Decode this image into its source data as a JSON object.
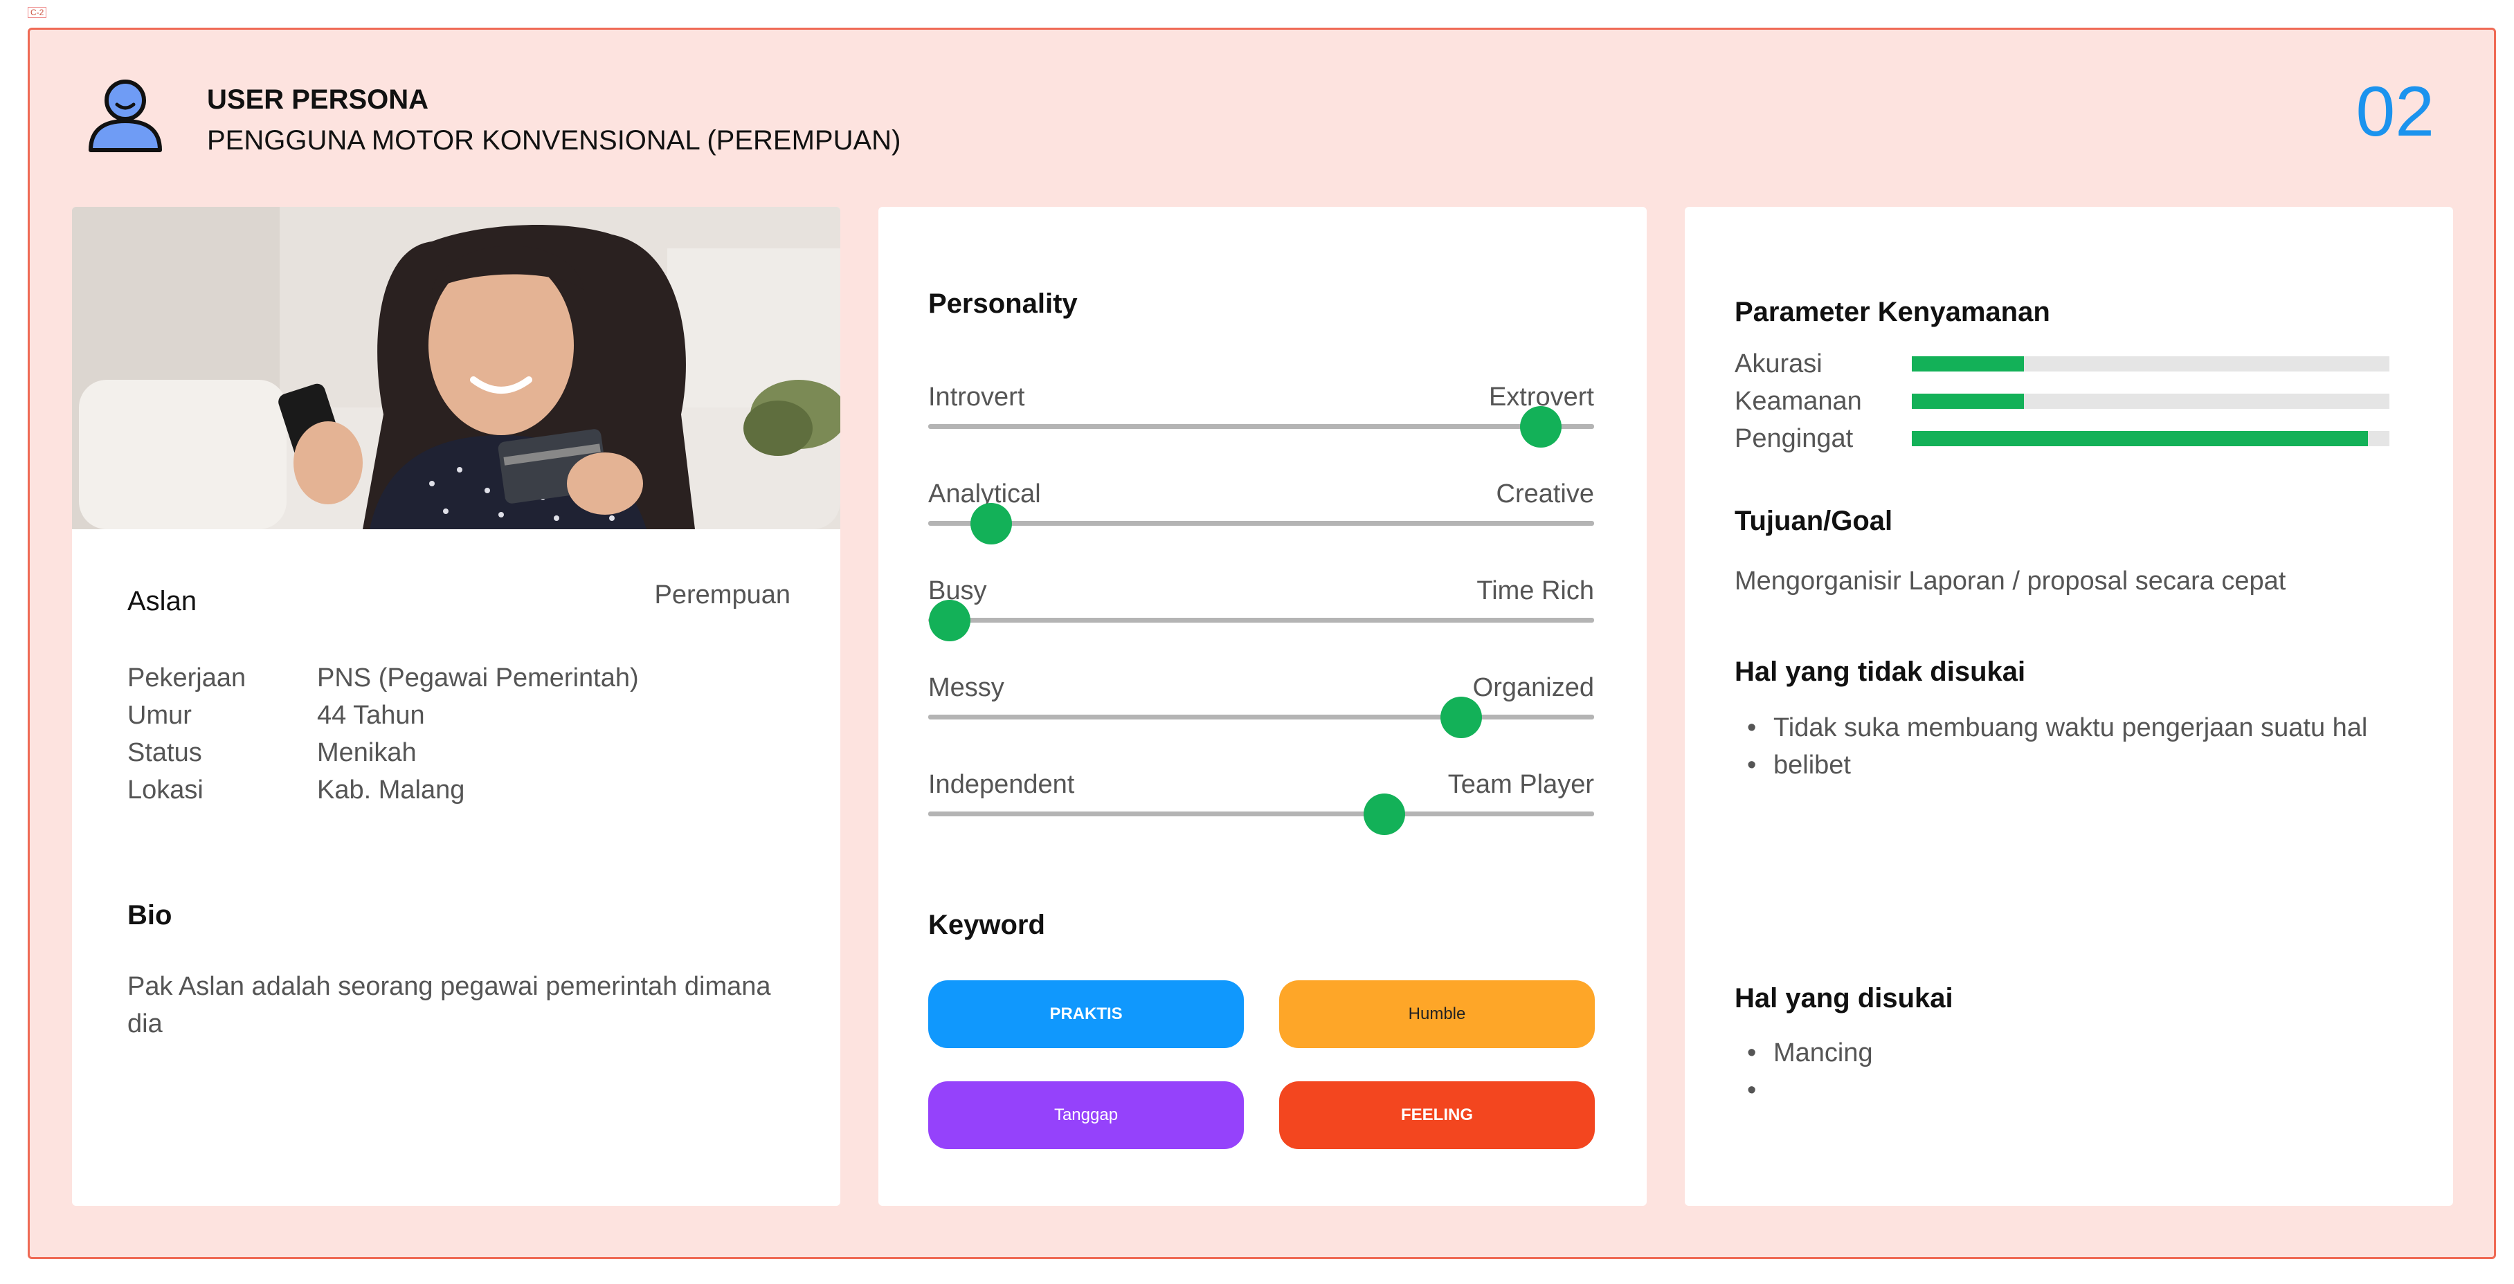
{
  "frame_label": "C-2",
  "header": {
    "icon": "user-icon",
    "title": "USER PERSONA",
    "subtitle": "PENGGUNA MOTOR KONVENSIONAL (PEREMPUAN)",
    "page_number": "02"
  },
  "profile": {
    "photo": "woman-holding-phone-and-card",
    "name": "Aslan",
    "gender": "Perempuan",
    "info": [
      {
        "key": "Pekerjaan",
        "value": "PNS (Pegawai Pemerintah)"
      },
      {
        "key": "Umur",
        "value": "44 Tahun"
      },
      {
        "key": "Status",
        "value": "Menikah"
      },
      {
        "key": "Lokasi",
        "value": "Kab. Malang"
      }
    ],
    "bio_title": "Bio",
    "bio_text": "Pak Aslan adalah seorang pegawai pemerintah dimana dia"
  },
  "personality": {
    "title": "Personality",
    "sliders": [
      {
        "left": "Introvert",
        "right": "Extrovert",
        "value": 0.92
      },
      {
        "left": "Analytical",
        "right": "Creative",
        "value": 0.095
      },
      {
        "left": "Busy",
        "right": "Time Rich",
        "value": 0.032
      },
      {
        "left": "Messy",
        "right": "Organized",
        "value": 0.8
      },
      {
        "left": "Independent",
        "right": "Team Player",
        "value": 0.685
      }
    ]
  },
  "keyword": {
    "title": "Keyword",
    "items": [
      {
        "label": "PRAKTIS",
        "color": "#1098fd",
        "bold": true
      },
      {
        "label": "Humble",
        "color": "#fea628",
        "text_color": "#222222"
      },
      {
        "label": "Tanggap",
        "color": "#9542fb"
      },
      {
        "label": "FEELING",
        "color": "#f3461f",
        "bold": true
      }
    ]
  },
  "comfort": {
    "title": "Parameter Kenyamanan",
    "params": [
      {
        "label": "Akurasi",
        "value": 0.235
      },
      {
        "label": "Keamanan",
        "value": 0.235
      },
      {
        "label": "Pengingat",
        "value": 0.955
      }
    ],
    "bar_color": "#13b158"
  },
  "goal": {
    "title": "Tujuan/Goal",
    "text": "Mengorganisir Laporan / proposal secara cepat"
  },
  "dislikes": {
    "title": "Hal yang tidak disukai",
    "items": [
      "Tidak suka membuang waktu pengerjaan suatu hal",
      "belibet"
    ]
  },
  "likes": {
    "title": "Hal yang disukai",
    "items": [
      "Mancing",
      ""
    ]
  },
  "colors": {
    "frame_bg": "#fde3df",
    "frame_border": "#ef6a55",
    "accent": "#1b93ee",
    "slider_knob": "#13b158"
  }
}
